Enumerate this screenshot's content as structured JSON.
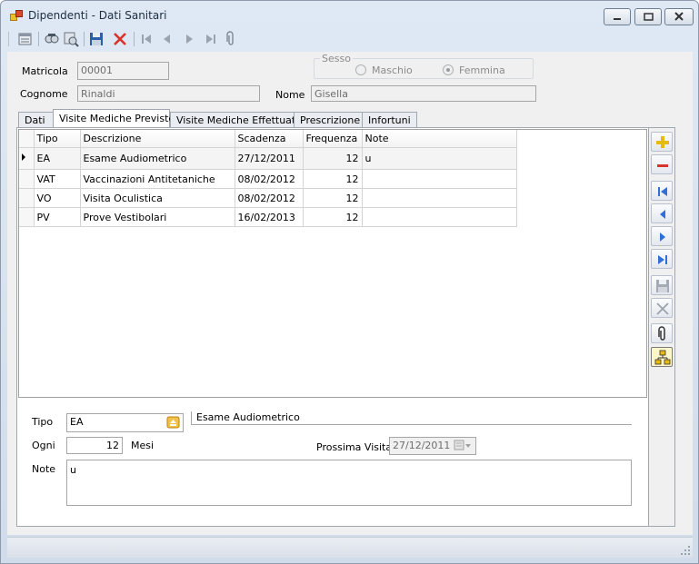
{
  "window": {
    "title": "Dipendenti - Dati Sanitari",
    "controls": [
      "minimize-icon",
      "maximize-icon",
      "close-icon"
    ]
  },
  "toolbar": {
    "icons": [
      "properties-icon",
      "find-icon",
      "find-next-icon",
      "save-icon",
      "delete-icon",
      "first-record-icon",
      "previous-record-icon",
      "next-record-icon",
      "last-record-icon",
      "attachment-icon"
    ]
  },
  "employee": {
    "matricola_label": "Matricola",
    "matricola_value": "00001",
    "cognome_label": "Cognome",
    "cognome_value": "Rinaldi",
    "nome_label": "Nome",
    "nome_value": "Gisella",
    "sesso_label": "Sesso",
    "sesso_options": [
      "Maschio",
      "Femmina"
    ],
    "sesso_selected": "Femmina"
  },
  "tabs": [
    {
      "label": "Dati",
      "active": false
    },
    {
      "label": "Visite Mediche Previste",
      "active": true
    },
    {
      "label": "Visite Mediche Effettuate",
      "active": false
    },
    {
      "label": "Prescrizione",
      "active": false
    },
    {
      "label": "Infortuni",
      "active": false
    }
  ],
  "grid": {
    "columns": [
      "Tipo",
      "Descrizione",
      "Scadenza",
      "Frequenza",
      "Note"
    ],
    "rows": [
      [
        "EA",
        "Esame Audiometrico",
        "27/12/2011",
        "12",
        "u"
      ],
      [
        "VAT",
        "Vaccinazioni Antitetaniche",
        "08/02/2012",
        "12",
        ""
      ],
      [
        "VO",
        "Visita Oculistica",
        "08/02/2012",
        "12",
        ""
      ],
      [
        "PV",
        "Prove Vestibolari",
        "16/02/2013",
        "12",
        ""
      ]
    ],
    "selected_row": 0
  },
  "side_buttons": [
    "add-icon",
    "remove-icon",
    "first-icon",
    "previous-icon",
    "next-icon",
    "last-icon",
    "save-icon",
    "cancel-icon",
    "attachment-icon",
    "hierarchy-icon"
  ],
  "detail": {
    "tipo_label": "Tipo",
    "tipo_value": "EA",
    "descrizione_value": "Esame Audiometrico",
    "ogni_label": "Ogni",
    "ogni_value": "12",
    "mesi_label": "Mesi",
    "prossima_label": "Prossima Visita",
    "prossima_value": "27/12/2011",
    "note_label": "Note",
    "note_value": "u"
  },
  "colors": {
    "title_bar": "#d0dcea",
    "client": "#f0f0f0",
    "accent_blue": "#2f6fd6",
    "add_yellow": "#e8b90f",
    "remove_red": "#d9332b"
  }
}
